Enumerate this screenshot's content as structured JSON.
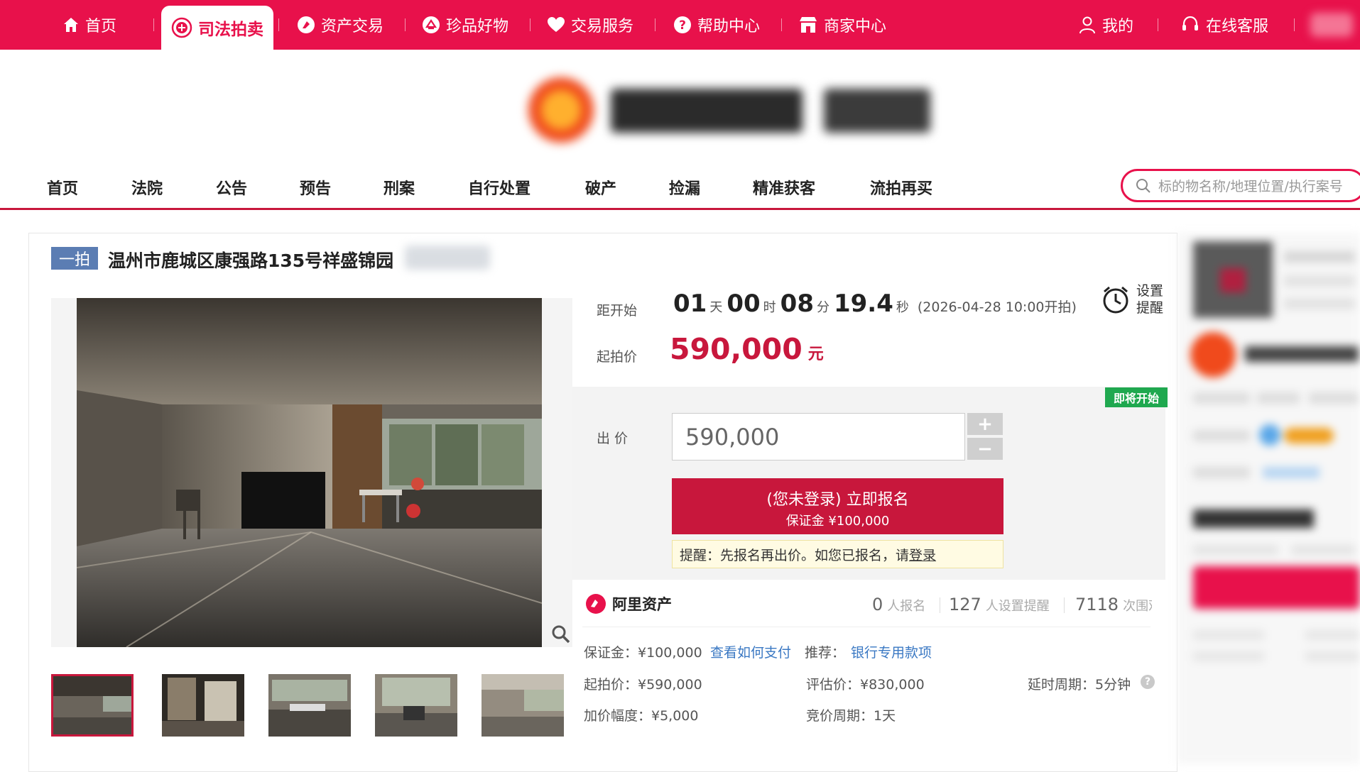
{
  "topnav": {
    "home": "首页",
    "judicial": "司法拍卖",
    "assets": "资产交易",
    "treasures": "珍品好物",
    "services": "交易服务",
    "help": "帮助中心",
    "merchant": "商家中心",
    "mine": "我的",
    "support": "在线客服"
  },
  "subnav": [
    "首页",
    "法院",
    "公告",
    "预告",
    "刑案",
    "自行处置",
    "破产",
    "捡漏",
    "精准获客",
    "流拍再买"
  ],
  "search": {
    "placeholder": "标的物名称/地理位置/执行案号"
  },
  "lot": {
    "badge": "一拍",
    "title": "温州市鹿城区康强路135号祥盛锦园"
  },
  "auction": {
    "countdown_label": "距开始",
    "days": "01",
    "days_unit": "天",
    "hours": "00",
    "hours_unit": "时",
    "minutes": "08",
    "minutes_unit": "分",
    "seconds": "19.4",
    "seconds_unit": "秒",
    "start_note": "(2026-04-28 10:00开拍)",
    "remind_label": "设置提醒",
    "start_price_label": "起拍价",
    "start_price": "590,000",
    "start_price_unit": "元",
    "status_badge": "即将开始",
    "bid_label": "出 价",
    "bid_value": "590,000",
    "plus": "+",
    "minus": "−",
    "signup_line1": "(您未登录) 立即报名",
    "signup_line2": "保证金 ¥100,000",
    "hint_text": "提醒：先报名再出价。如您已报名，请",
    "hint_link": "登录"
  },
  "stats": {
    "brand": "阿里资产",
    "signups": "0",
    "signups_unit": "人报名",
    "reminders": "127",
    "reminders_unit": "人设置提醒",
    "views": "7118",
    "views_unit": "次围观"
  },
  "details": {
    "deposit": "保证金：¥100,000",
    "how_to_pay": "查看如何支付",
    "recommend_label": "推荐：",
    "recommend_link": "银行专用款项",
    "start_price": "起拍价：¥590,000",
    "appraisal": "评估价：¥830,000",
    "delay": "延时周期：5分钟",
    "increment": "加价幅度：¥5,000",
    "cycle": "竞价周期：1天",
    "help": "?"
  },
  "colors": {
    "brand_red": "#e8114b",
    "price_red": "#c8173c",
    "link_blue": "#3a78c3",
    "badge_blue": "#5b7db3",
    "soon_green": "#1fa84f"
  },
  "icons": [
    "home-icon",
    "court-icon",
    "asset-icon",
    "gem-icon",
    "heart-icon",
    "help-icon",
    "store-icon",
    "user-icon",
    "headset-icon",
    "search-icon",
    "alarm-icon",
    "zoom-icon",
    "alibaba-icon"
  ]
}
